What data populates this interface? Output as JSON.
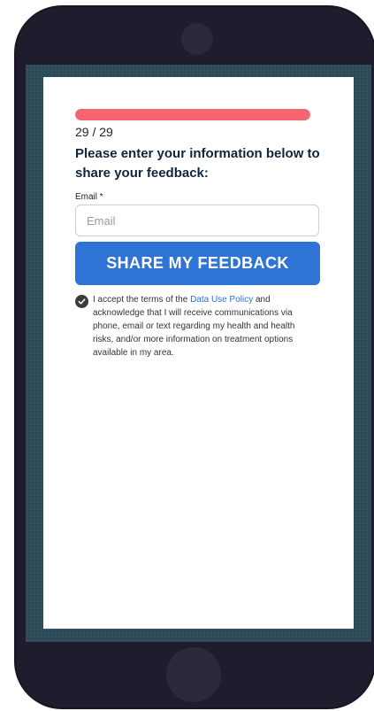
{
  "progress": {
    "current": 29,
    "total": 29,
    "label": "29 / 29"
  },
  "form": {
    "heading": "Please enter your information below to share your feedback:",
    "email_label": "Email *",
    "email_placeholder": "Email",
    "email_value": "",
    "submit_label": "SHARE MY FEEDBACK"
  },
  "consent": {
    "checked": true,
    "text_before": "I accept the terms of the ",
    "link_text": "Data Use Policy",
    "text_after": " and acknowledge that I will receive communications via phone, email or text regarding my health and health risks, and/or more information on treatment options available in my area."
  },
  "icons": {
    "checkbox": "checkmark-icon",
    "camera": "camera-icon",
    "home": "home-button-icon"
  },
  "colors": {
    "progress_fill": "#f76570",
    "button": "#2f73d4",
    "link": "#2f73d4",
    "heading": "#11243d",
    "checkbox": "#3b3b3b"
  }
}
